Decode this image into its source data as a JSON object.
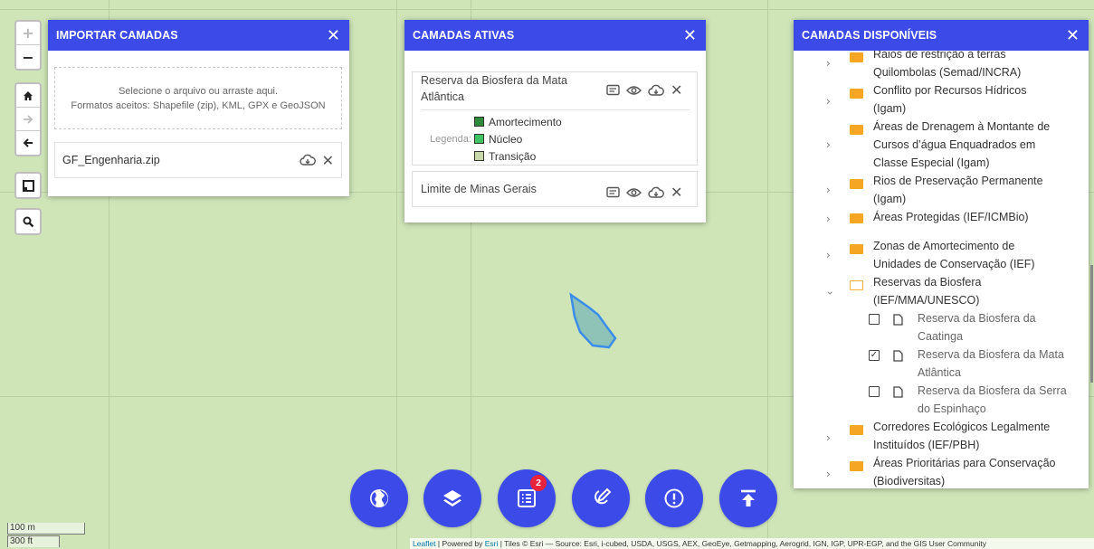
{
  "map": {
    "zoom_in": "+",
    "zoom_out": "−",
    "home_icon": "home-icon",
    "forward_icon": "arrow-right-icon",
    "back_icon": "arrow-left-icon",
    "fullscreen_icon": "fullscreen-icon",
    "search_icon": "search-icon",
    "polygon_fill": "#8fc3b8",
    "polygon_stroke": "#3b8ee8"
  },
  "import_panel": {
    "title": "IMPORTAR CAMADAS",
    "dropzone_line1": "Selecione o arquivo ou arraste aqui.",
    "dropzone_line2": "Formatos aceitos: Shapefile (zip), KML, GPX e GeoJSON",
    "file_name": "GF_Engenharia.zip"
  },
  "active_panel": {
    "title": "CAMADAS ATIVAS",
    "layer1_line1": "Reserva da Biosfera da Mata",
    "layer1_line2": "Atlântica",
    "legend_label": "Legenda:",
    "legend": [
      {
        "label": "Amortecimento",
        "color": "#2e8b3a"
      },
      {
        "label": "Núcleo",
        "color": "#3ec463"
      },
      {
        "label": "Transição",
        "color": "#c8d8a8"
      }
    ],
    "layer2": "Limite de Minas Gerais"
  },
  "available_panel": {
    "title": "CAMADAS DISPONÍVEIS",
    "items": [
      {
        "l1": "Raios de restrição a terras",
        "l2": "Quilombolas (Semad/INCRA)"
      },
      {
        "l1": "Conflito por Recursos Hídricos",
        "l2": "(Igam)"
      },
      {
        "l1": "Áreas de Drenagem à Montante de",
        "l2": "Cursos d’água Enquadrados em",
        "l3": "Classe Especial (Igam)"
      },
      {
        "l1": "Rios de Preservação Permanente",
        "l2": "(Igam)"
      },
      {
        "l1": "Áreas Protegidas (IEF/ICMBio)"
      },
      {
        "l1": "Zonas de Amortecimento de",
        "l2": "Unidades de Conservação (IEF)"
      },
      {
        "l1": "Reservas da Biosfera",
        "l2": "(IEF/MMA/UNESCO)"
      },
      {
        "l1": "Corredores Ecológicos Legalmente",
        "l2": "Instituídos (IEF/PBH)"
      },
      {
        "l1": "Áreas Prioritárias para Conservação",
        "l2": "(Biodiversitas)"
      }
    ],
    "leaves": [
      {
        "l1": "Reserva da Biosfera da",
        "l2": "Caatinga",
        "checked": ""
      },
      {
        "l1": "Reserva da Biosfera da Mata",
        "l2": "Atlântica",
        "checked": "✓"
      },
      {
        "l1": "Reserva da Biosfera da Serra",
        "l2": "do Espinhaço",
        "checked": ""
      }
    ]
  },
  "fab_bar": {
    "badge": "2",
    "buttons": [
      "globe-icon",
      "layers-icon",
      "list-icon",
      "edit-map-icon",
      "alert-icon",
      "upload-icon"
    ]
  },
  "scale": {
    "metric": "100 m",
    "imperial": "300 ft"
  },
  "attribution": {
    "leaflet": "Leaflet",
    "powered": " | Powered by ",
    "esri": "Esri",
    "rest": " | Tiles © Esri — Source: Esri, i-cubed, USDA, USGS, AEX, GeoEye, Getmapping, Aerogrid, IGN, IGP, UPR-EGP, and the GIS User Community"
  }
}
